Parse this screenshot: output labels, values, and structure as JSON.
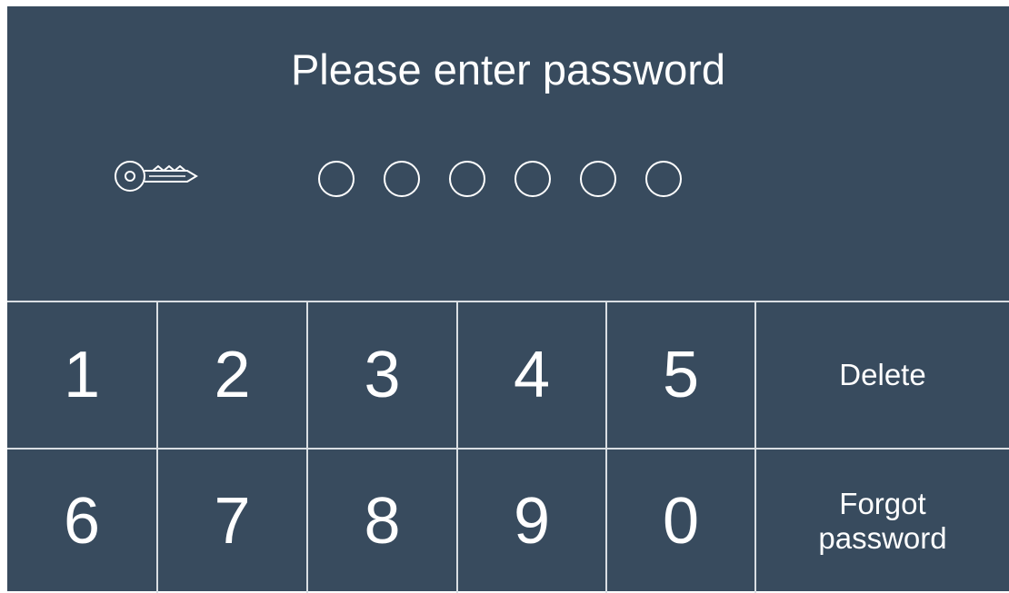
{
  "header": {
    "title": "Please enter password",
    "icon": "key-icon",
    "password_length": 6,
    "entered_count": 0
  },
  "keypad": {
    "rows": [
      [
        "1",
        "2",
        "3",
        "4",
        "5",
        "Delete"
      ],
      [
        "6",
        "7",
        "8",
        "9",
        "0",
        "Forgot\npassword"
      ]
    ]
  },
  "colors": {
    "background": "#384b5e",
    "foreground": "#ffffff",
    "divider": "#d9dee3"
  }
}
